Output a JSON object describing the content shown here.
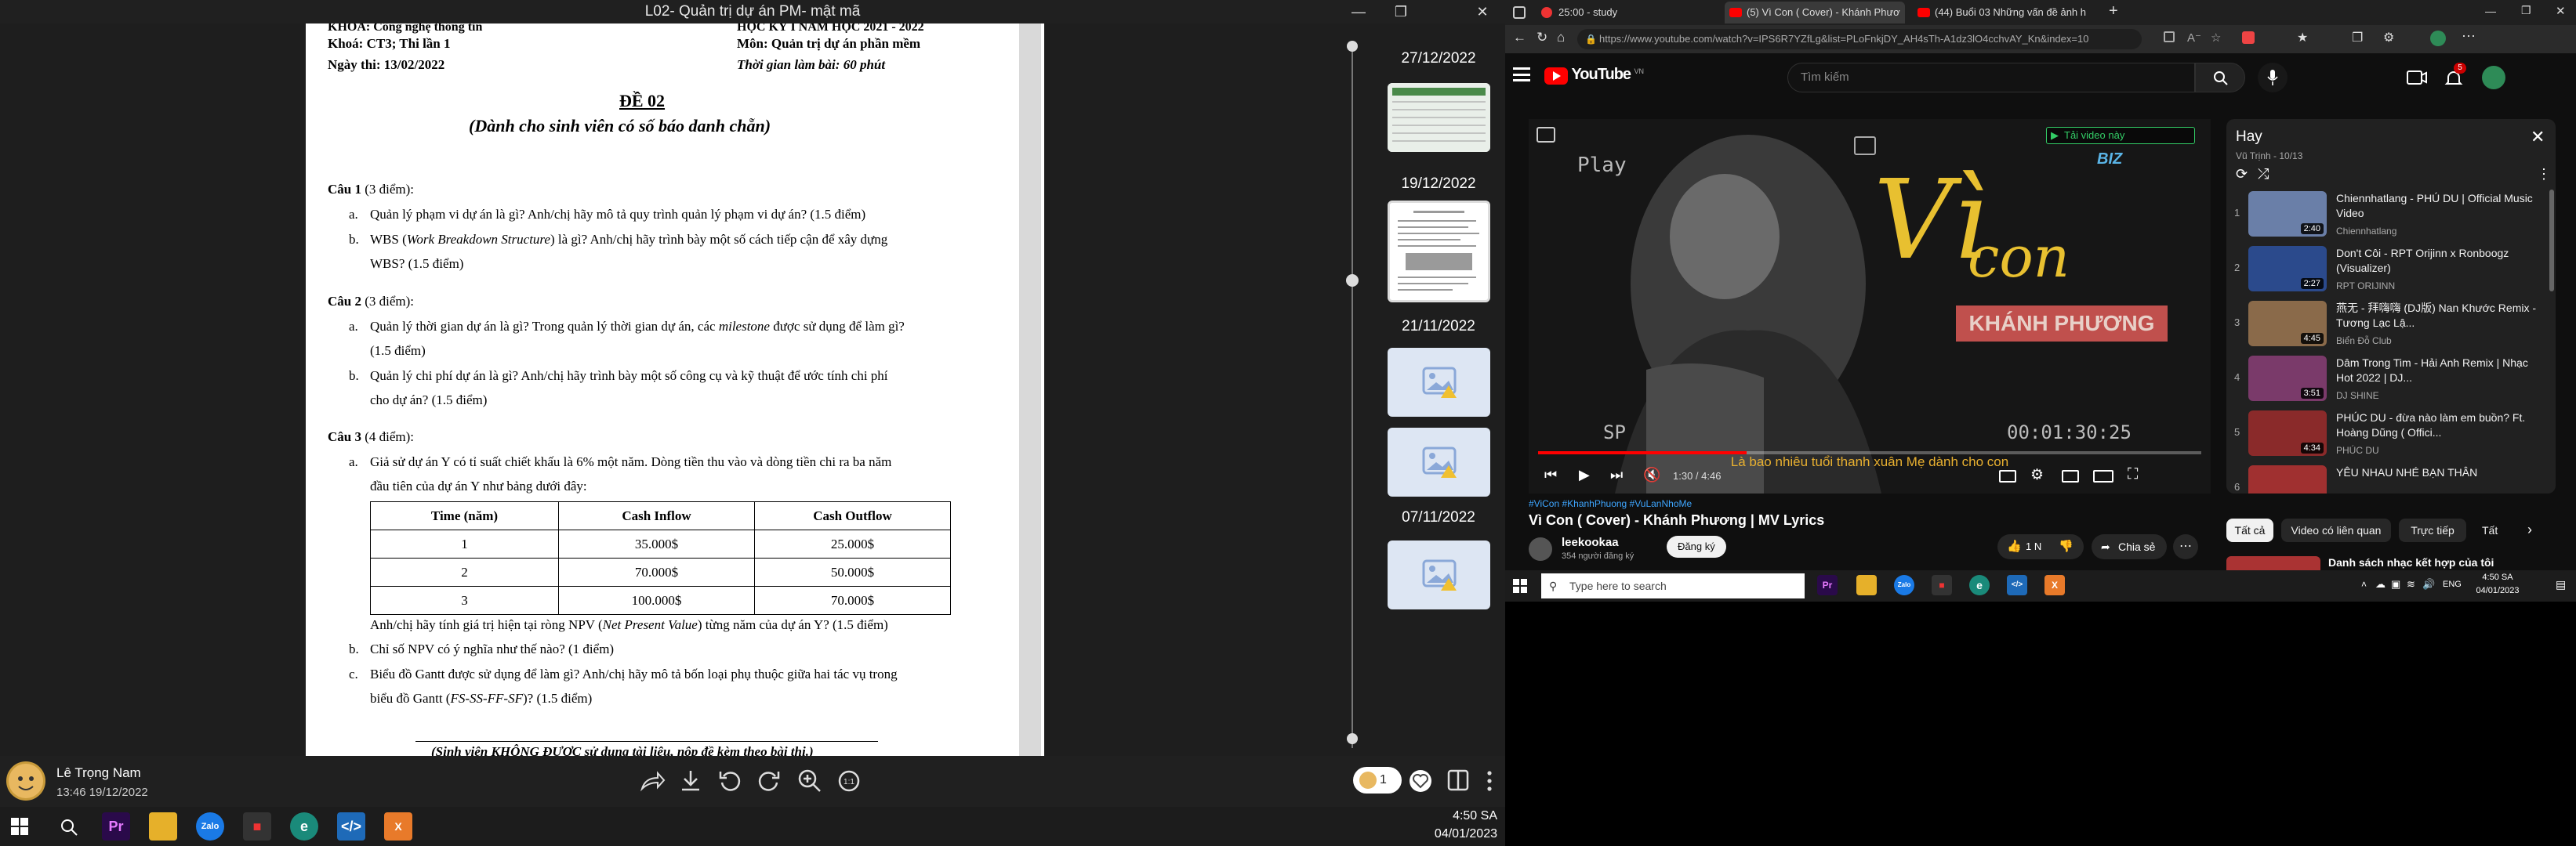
{
  "photos_app": {
    "window_title": "L02- Quản trị dự án PM- mật mã",
    "exam": {
      "header_left": [
        "KHOA: Công nghệ thông tin",
        "Khoá: CT3; Thi lần 1",
        "Ngày thi: 13/02/2022"
      ],
      "header_right": [
        "HỌC KỲ I NĂM HỌC 2021 - 2022",
        "Môn: Quản trị dự án phần mềm",
        "Thời gian làm bài: 60 phút"
      ],
      "de_title": "ĐỀ 02",
      "de_subtitle": "(Dành cho sinh viên  có số báo danh chẵn)",
      "cau1_label": "Câu 1",
      "cau1_points": " (3 điểm):",
      "cau1a": "Quản lý phạm vi dự án là gì? Anh/chị hãy mô tả quy trình quản lý phạm vi dự án? (1.5 điểm)",
      "cau1b_1": "WBS (",
      "cau1b_2": "Work Breakdown Structure",
      "cau1b_3": ") là gì? Anh/chị hãy trình bày một số cách tiếp cận để xây dựng",
      "cau1b_cont": "WBS? (1.5 điểm)",
      "cau2_label": "Câu 2",
      "cau2_points": " (3 điểm):",
      "cau2a_1": "Quản lý thời gian dự án là gì? Trong quản lý thời gian dự án, các ",
      "cau2a_2": "milestone",
      "cau2a_3": " được sử dụng để làm gì?",
      "cau2a_cont": "(1.5 điểm)",
      "cau2b": "Quản lý chi phí dự án là gì? Anh/chị hãy trình bày một số công cụ và kỹ thuật để ước tính chi phí",
      "cau2b_cont": "cho dự án? (1.5 điểm)",
      "cau3_label": "Câu 3",
      "cau3_points": " (4 điểm):",
      "cau3a": "Giả sử dự án Y có tỉ suất chiết khấu là 6% một năm. Dòng tiền thu vào và dòng tiền chi ra ba năm",
      "cau3a_cont": "đầu tiên của dự án Y như bảng dưới đây:",
      "table_headers": [
        "Time (năm)",
        "Cash Inflow",
        "Cash Outflow"
      ],
      "table_rows": [
        [
          "1",
          "35.000$",
          "25.000$"
        ],
        [
          "2",
          "70.000$",
          "50.000$"
        ],
        [
          "3",
          "100.000$",
          "70.000$"
        ]
      ],
      "npv_1": "Anh/chị hãy tính giá trị hiện tại ròng NPV (",
      "npv_2": "Net Present Value",
      "npv_3": ") từng năm của dự án Y? (1.5 điểm)",
      "cau3b": "Chỉ số NPV có ý nghĩa như thế nào? (1 điểm)",
      "cau3c": "Biểu đồ Gantt được sử dụng để làm gì? Anh/chị hãy mô tả bốn loại phụ thuộc giữa hai tác vụ trong",
      "cau3c_cont_1": "biểu đồ Gantt (",
      "cau3c_cont_2": "FS-SS-FF-SF",
      "cau3c_cont_3": ")? (1.5 điểm)",
      "footer": "(Sinh viên KHÔNG ĐƯỢC sử dụng tài liệu, nộp đề kèm theo bài thi.)",
      "letter_a": "a.",
      "letter_b": "b.",
      "letter_c": "c."
    },
    "timeline_dates": [
      "27/12/2022",
      "19/12/2022",
      "21/11/2022",
      "07/11/2022"
    ],
    "user_name": "Lê Trọng Nam",
    "photo_datetime": "13:46 19/12/2022",
    "people_count": "1"
  },
  "taskbar_left": {
    "time": "4:50 SA",
    "date": "04/01/2023"
  },
  "browser": {
    "tabs": [
      "25:00 - study",
      "(5) Vì Con ( Cover) - Khánh Phươ",
      "(44) Buổi 03 Những vấn đề ảnh h"
    ],
    "url": "https://www.youtube.com/watch?v=IPS6R7YZfLg&list=PLoFnkjDY_AH4sTh-A1dz3lO4cchvAY_Kn&index=10"
  },
  "youtube": {
    "logo_text": "YouTube",
    "region": "VN",
    "search_placeholder": "Tìm kiếm",
    "notif_count": "5",
    "video_overlay": {
      "download_label": "Tải video này",
      "play_text": "Play",
      "vi_text": "Vì",
      "con_text": "con",
      "artist_banner": "KHÁNH PHƯƠNG",
      "sp_text": "SP",
      "timecode": "00:01:30:25",
      "subtitle": "Là bao nhiêu tuổi thanh xuân Mẹ dành cho con"
    },
    "time_display": "1:30 / 4:46",
    "hashtags": "#ViCon #KhanhPhuong #VuLanNhoMe",
    "title": "Vì Con ( Cover) - Khánh Phương | MV Lyrics",
    "channel": "leekookaa",
    "subs": "354 người đăng ký",
    "subscribe": "Đăng ký",
    "likes": "1 N",
    "share": "Chia sẻ",
    "queue_title": "Hay",
    "queue_sub": "Vũ Trịnh - 10/13",
    "queue": [
      {
        "num": "1",
        "title": "Chiennhatlang - PHÚ DU | Official Music Video",
        "channel": "Chiennhatlang",
        "duration": "2:40",
        "color": "#6a7fa8"
      },
      {
        "num": "2",
        "title": "Don't Côi - RPT Orijinn x Ronboogz (Visualizer)",
        "channel": "RPT ORIJINN",
        "duration": "2:27",
        "color": "#2b4a8c"
      },
      {
        "num": "3",
        "title": "燕无 - 拜嗨嗨 (DJ版) Nan Khước Remix - Tương Lạc Lậ...",
        "channel": "Biển Đỗ Club",
        "duration": "4:45",
        "color": "#8a6a4a"
      },
      {
        "num": "4",
        "title": "Dâm Trong Tim - Hải Anh Remix | Nhạc Hot 2022 | DJ...",
        "channel": "DJ SHINE",
        "duration": "3:51",
        "color": "#7a3a6a"
      },
      {
        "num": "5",
        "title": "PHÚC DU - đừa nào làm em buồn? Ft. Hoàng Dũng ( Offici...",
        "channel": "PHÚC DU",
        "duration": "4:34",
        "color": "#8a2a2a"
      },
      {
        "num": "6",
        "title": "YÊU NHAU NHÉ BẠN THÂN",
        "channel": "",
        "duration": "",
        "color": "#a03030"
      }
    ],
    "chips": [
      "Tất cả",
      "Video có liên quan",
      "Trực tiếp",
      "Tất"
    ],
    "rec_title": "Danh sách nhạc kết hợp của tôi"
  },
  "taskbar_right": {
    "search_placeholder": "Type here to search",
    "lang": "ENG",
    "time": "4:50 SA",
    "date": "04/01/2023"
  }
}
